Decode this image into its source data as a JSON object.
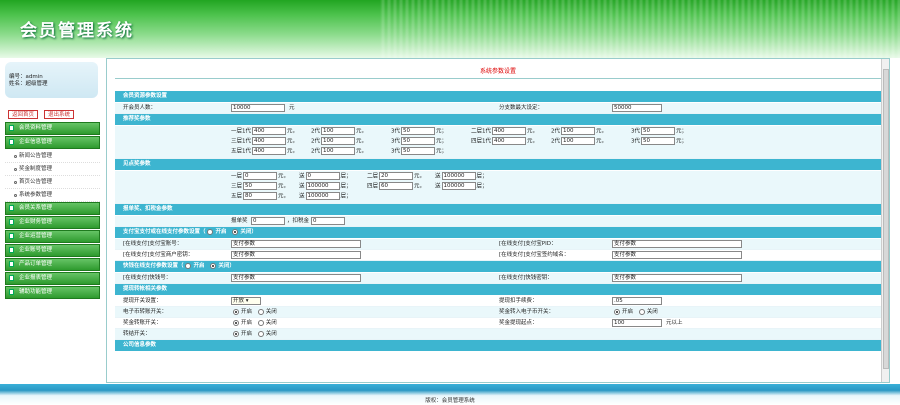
{
  "header": {
    "title": "会员管理系统"
  },
  "sidebar": {
    "user": {
      "line1": "编号：admin",
      "line2": "姓名：超级管理"
    },
    "buttons": {
      "home": "返回首页",
      "exit": "退出系统"
    },
    "items": [
      {
        "type": "group",
        "label": "会员资料管理"
      },
      {
        "type": "group",
        "label": "企业信息管理"
      },
      {
        "type": "sub",
        "label": "新闻公告管理"
      },
      {
        "type": "sub",
        "label": "奖金制度管理"
      },
      {
        "type": "sub",
        "label": "首页公告管理"
      },
      {
        "type": "sub",
        "label": "系统参数管理"
      },
      {
        "type": "group",
        "label": "会员关系管理"
      },
      {
        "type": "group",
        "label": "企业财务管理"
      },
      {
        "type": "group",
        "label": "企业运营管理"
      },
      {
        "type": "group",
        "label": "企业账号管理"
      },
      {
        "type": "group",
        "label": "产品订单管理"
      },
      {
        "type": "group",
        "label": "企业报表管理"
      },
      {
        "type": "group",
        "label": "辅助功能管理"
      }
    ]
  },
  "main": {
    "page_title": "系统参数设置",
    "s1": {
      "head": "会员资源参数设置",
      "r1": {
        "l1": "开会员人数：",
        "v1": "10000",
        "u1": "元",
        "l2": "分支数最大设定：",
        "v2": "50000"
      }
    },
    "s2": {
      "head": "推荐奖参数",
      "rows": [
        [
          {
            "pre": "一层1代",
            "val": "400",
            "unit": "元，"
          },
          {
            "pre": "2代",
            "val": "100",
            "unit": "元，"
          },
          {
            "pre": "3代",
            "val": "50",
            "unit": "元；"
          },
          {
            "pre": "二层1代",
            "val": "400",
            "unit": "元，"
          },
          {
            "pre": "2代",
            "val": "100",
            "unit": "元，"
          },
          {
            "pre": "3代",
            "val": "50",
            "unit": "元；"
          }
        ],
        [
          {
            "pre": "三层1代",
            "val": "400",
            "unit": "元，"
          },
          {
            "pre": "2代",
            "val": "100",
            "unit": "元，"
          },
          {
            "pre": "3代",
            "val": "50",
            "unit": "元；"
          },
          {
            "pre": "四层1代",
            "val": "400",
            "unit": "元，"
          },
          {
            "pre": "2代",
            "val": "100",
            "unit": "元，"
          },
          {
            "pre": "3代",
            "val": "50",
            "unit": "元；"
          }
        ],
        [
          {
            "pre": "五层1代",
            "val": "400",
            "unit": "元，"
          },
          {
            "pre": "2代",
            "val": "100",
            "unit": "元，"
          },
          {
            "pre": "3代",
            "val": "50",
            "unit": "元；"
          }
        ]
      ]
    },
    "s3": {
      "head": "见点奖参数",
      "rows": [
        [
          {
            "pre": "一层",
            "val": "0",
            "unit": "元，"
          },
          {
            "pre": "送",
            "val": "0",
            "unit": "层；"
          },
          {
            "pre": "二层",
            "val": "20",
            "unit": "元，"
          },
          {
            "pre": "送",
            "val": "100000",
            "unit": "层；"
          }
        ],
        [
          {
            "pre": "三层",
            "val": "50",
            "unit": "元，"
          },
          {
            "pre": "送",
            "val": "100000",
            "unit": "层；"
          },
          {
            "pre": "四层",
            "val": "60",
            "unit": "元，"
          },
          {
            "pre": "送",
            "val": "100000",
            "unit": "层；"
          }
        ],
        [
          {
            "pre": "五层",
            "val": "80",
            "unit": "元，"
          },
          {
            "pre": "送",
            "val": "100000",
            "unit": "层；"
          }
        ]
      ]
    },
    "s4": {
      "head": "报单奖、扣税金参数",
      "l1": "报单奖",
      "v1": "0",
      "l2": "，扣税金",
      "v2": "0"
    },
    "s5": {
      "head": "支付宝支付或在线支付参数设置（",
      "open": "开启",
      "close": "关闭",
      "tail": "）",
      "r1": {
        "l1": "[在线支付]支付宝账号：",
        "v1": "支付参数",
        "l2": "[在线支付]支付宝PID：",
        "v2": "支付参数"
      },
      "r2": {
        "l1": "[在线支付]支付宝商户密钥：",
        "v1": "支付参数",
        "l2": "[在线支付]支付宝签约域名：",
        "v2": "支付参数"
      }
    },
    "s6": {
      "head": "快钱在线支付参数设置（",
      "open": "开启",
      "close": "关闭",
      "tail": "）",
      "r1": {
        "l1": "[在线支付]快钱号：",
        "v1": "支付参数",
        "l2": "[在线支付]快钱密钥：",
        "v2": "支付参数"
      }
    },
    "s7": {
      "head": "提现转帐相关参数",
      "r1": {
        "l1": "提现开关设置：",
        "sel": "开放",
        "l2": "提现扣手续费：",
        "v2": ".05"
      },
      "r2": {
        "l1": "电子币转账开关：",
        "open": "开启",
        "close": "关闭",
        "l2": "奖金转入电子币开关：",
        "open2": "开启",
        "close2": "关闭"
      },
      "r3": {
        "l1": "奖金转账开关：",
        "open": "开启",
        "close": "关闭",
        "l2": "奖金提现起点：",
        "v2": "100",
        "u2": "元以上"
      },
      "r4": {
        "l1": "转结开关：",
        "open": "开启",
        "close": "关闭"
      }
    },
    "s8": {
      "head": "公司信息参数"
    }
  },
  "footer": {
    "text": "版权：会员管理系统"
  }
}
